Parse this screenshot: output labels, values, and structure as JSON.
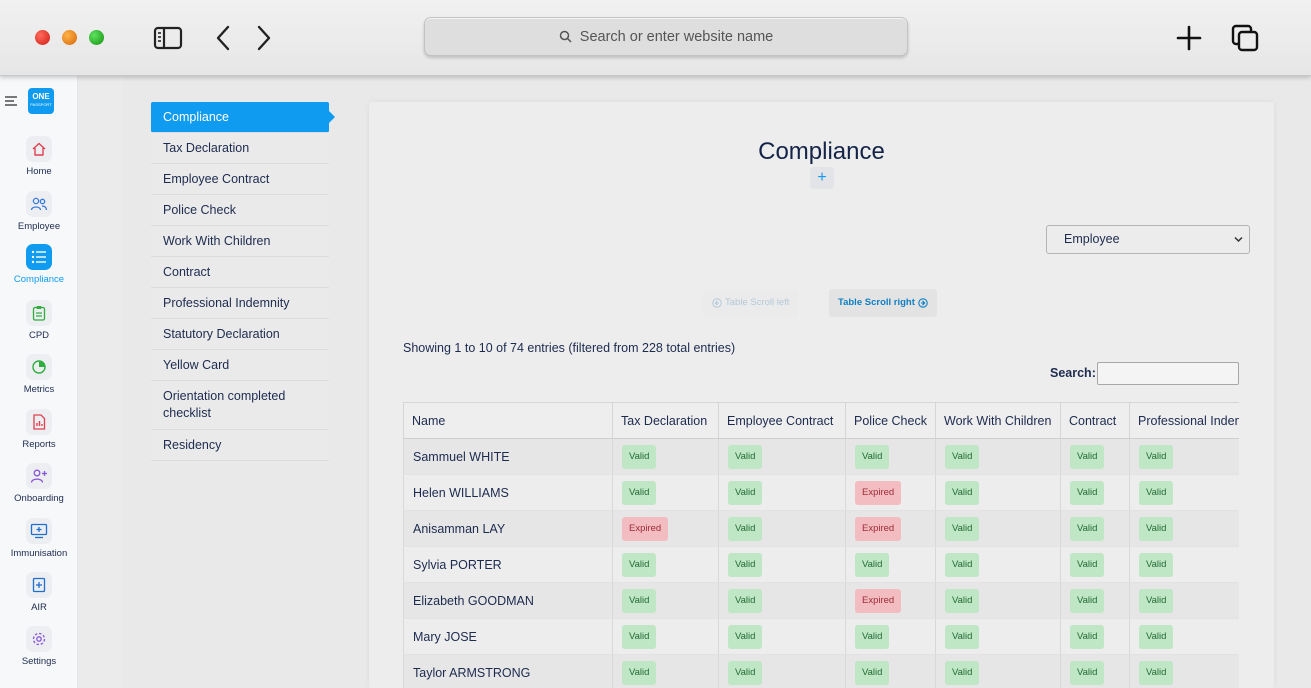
{
  "browser": {
    "address_placeholder": "Search or enter website name"
  },
  "app": {
    "logo_text": "ONE",
    "logo_sub": "PASSPORT"
  },
  "nav": [
    {
      "label": "Home",
      "icon": "home-icon"
    },
    {
      "label": "Employee",
      "icon": "users-icon"
    },
    {
      "label": "Compliance",
      "icon": "list-icon",
      "active": true
    },
    {
      "label": "CPD",
      "icon": "clipboard-icon"
    },
    {
      "label": "Metrics",
      "icon": "pie-chart-icon"
    },
    {
      "label": "Reports",
      "icon": "report-icon"
    },
    {
      "label": "Onboarding",
      "icon": "user-plus-icon"
    },
    {
      "label": "Immunisation",
      "icon": "monitor-plus-icon"
    },
    {
      "label": "AIR",
      "icon": "book-plus-icon"
    },
    {
      "label": "Settings",
      "icon": "gear-icon"
    }
  ],
  "side_menu": [
    "Compliance",
    "Tax Declaration",
    "Employee Contract",
    "Police Check",
    "Work With Children",
    "Contract",
    "Professional Indemnity",
    "Statutory Declaration",
    "Yellow Card",
    "Orientation completed checklist",
    "Residency"
  ],
  "main": {
    "title": "Compliance",
    "add_label": "+",
    "select_value": "Employee",
    "scroll_left": "Table Scroll left",
    "scroll_right": "Table Scroll right",
    "showing": "Showing 1 to 10 of 74 entries (filtered from 228 total entries)",
    "search_label": "Search:"
  },
  "table": {
    "headers": [
      "Name",
      "Tax Declaration",
      "Employee Contract",
      "Police Check",
      "Work With Children",
      "Contract",
      "Professional Indemnity"
    ],
    "rows": [
      {
        "name": "Sammuel WHITE",
        "status": [
          "Valid",
          "Valid",
          "Valid",
          "Valid",
          "Valid",
          "Valid"
        ]
      },
      {
        "name": "Helen WILLIAMS",
        "status": [
          "Valid",
          "Valid",
          "Expired",
          "Valid",
          "Valid",
          "Valid"
        ]
      },
      {
        "name": "Anisamman LAY",
        "status": [
          "Expired",
          "Valid",
          "Expired",
          "Valid",
          "Valid",
          "Valid"
        ]
      },
      {
        "name": "Sylvia PORTER",
        "status": [
          "Valid",
          "Valid",
          "Valid",
          "Valid",
          "Valid",
          "Valid"
        ]
      },
      {
        "name": "Elizabeth GOODMAN",
        "status": [
          "Valid",
          "Valid",
          "Expired",
          "Valid",
          "Valid",
          "Valid"
        ]
      },
      {
        "name": "Mary JOSE",
        "status": [
          "Valid",
          "Valid",
          "Valid",
          "Valid",
          "Valid",
          "Valid"
        ]
      },
      {
        "name": "Taylor ARMSTRONG",
        "status": [
          "Valid",
          "Valid",
          "Valid",
          "Valid",
          "Valid",
          "Valid"
        ]
      }
    ]
  },
  "colors": {
    "accent": "#0f9bf0",
    "valid_bg": "#bfe6c5",
    "expired_bg": "#f2bcc1"
  }
}
